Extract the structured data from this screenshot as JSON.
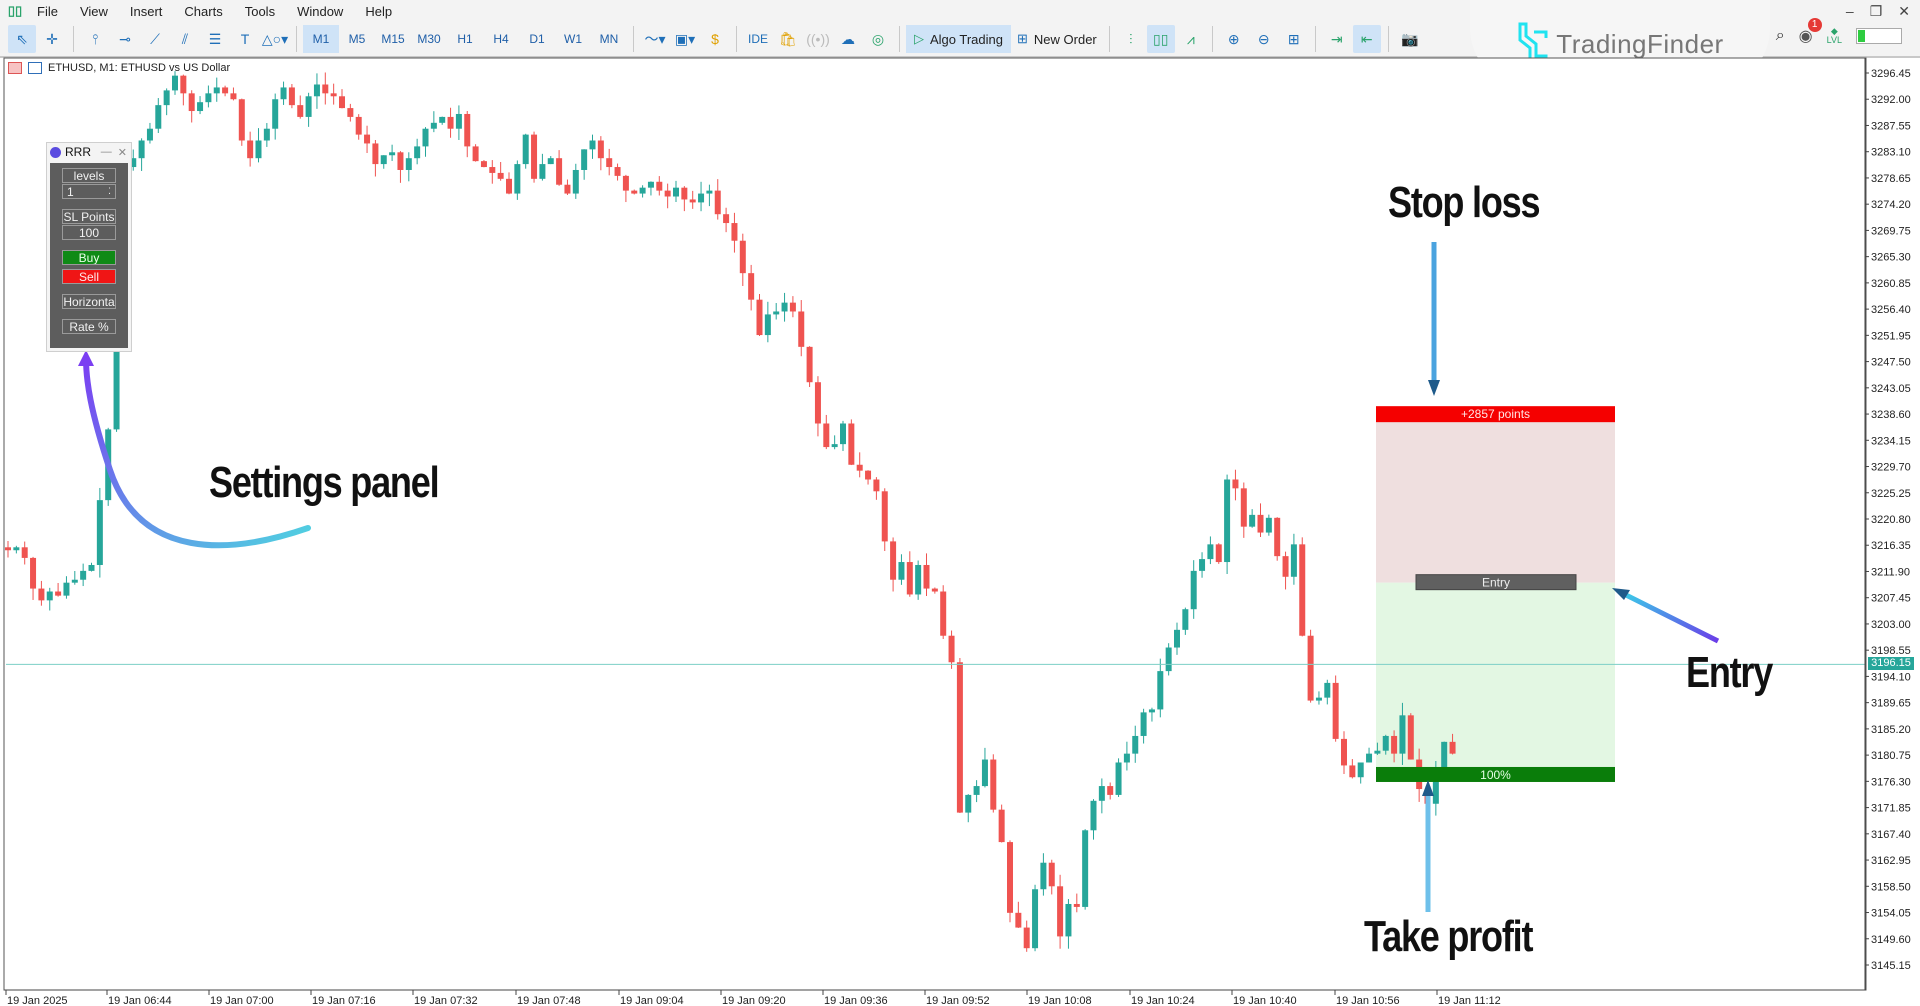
{
  "app": {
    "menu": [
      "File",
      "View",
      "Insert",
      "Charts",
      "Tools",
      "Window",
      "Help"
    ],
    "timeframes": [
      "M1",
      "M5",
      "M15",
      "M30",
      "H1",
      "H4",
      "D1",
      "W1",
      "MN"
    ],
    "active_timeframe": "M1",
    "toolbar": {
      "ide_label": "IDE",
      "algo_trading_label": "Algo Trading",
      "new_order_label": "New Order"
    },
    "notification_count": "1",
    "level_label": "LVL",
    "watermark": "TradingFinder"
  },
  "chart_header": {
    "title": "ETHUSD, M1:  ETHUSD vs US Dollar"
  },
  "settings_panel": {
    "title": "RRR",
    "levels_label": "levels",
    "levels_value": "1",
    "sl_points_label": "SL Points",
    "sl_points_value": "100",
    "buy_label": "Buy",
    "sell_label": "Sell",
    "horizontal_label": "Horizonta",
    "rate_label": "Rate %"
  },
  "annotations": {
    "settings_panel": "Settings panel",
    "stop_loss": "Stop loss",
    "entry": "Entry",
    "take_profit": "Take profit"
  },
  "rrr_box": {
    "sl_label": "+2857 points",
    "entry_label": "Entry",
    "tp_label": "100%",
    "sl_price": 3239.6,
    "entry_price": 3210.0,
    "tp_price": 3178.4,
    "colors": {
      "sl_bar": "#f50000",
      "sl_zone": "#efdfdf",
      "entry_bar": "#606060",
      "tp_zone": "#e3f7e3",
      "tp_bar": "#0a7d0a"
    }
  },
  "chart_data": {
    "type": "candlestick",
    "symbol": "ETHUSD",
    "timeframe": "M1",
    "current_price": 3196.15,
    "current_price_label": "3196.15",
    "ylim": [
      3142.0,
      3299.0
    ],
    "y_ticks": [
      "3296.45",
      "3292.00",
      "3287.55",
      "3283.10",
      "3278.65",
      "3274.20",
      "3269.75",
      "3265.30",
      "3260.85",
      "3256.40",
      "3251.95",
      "3247.50",
      "3243.05",
      "3238.60",
      "3234.15",
      "3229.70",
      "3225.25",
      "3220.80",
      "3216.35",
      "3211.90",
      "3207.45",
      "3203.00",
      "3198.55",
      "3194.10",
      "3189.65",
      "3185.20",
      "3180.75",
      "3176.30",
      "3171.85",
      "3167.40",
      "3162.95",
      "3158.50",
      "3154.05",
      "3149.60",
      "3145.15"
    ],
    "x_ticks": [
      "19 Jan 2025",
      "19 Jan 06:44",
      "19 Jan 07:00",
      "19 Jan 07:16",
      "19 Jan 07:32",
      "19 Jan 07:48",
      "19 Jan 09:04",
      "19 Jan 09:20",
      "19 Jan 09:36",
      "19 Jan 09:52",
      "19 Jan 10:08",
      "19 Jan 10:24",
      "19 Jan 10:40",
      "19 Jan 10:56",
      "19 Jan 11:12"
    ],
    "colors": {
      "up": "#26a69a",
      "down": "#ef5350",
      "price_line": "#7ccfc6"
    },
    "closes": [
      3215.5,
      3216.0,
      3214.2,
      3209.0,
      3207.0,
      3208.5,
      3207.8,
      3210.0,
      3210.5,
      3212.0,
      3213.0,
      3224.0,
      3236.0,
      3279.0,
      3280.5,
      3282.0,
      3285.0,
      3287.0,
      3291.0,
      3293.5,
      3296.0,
      3293.0,
      3290.0,
      3291.5,
      3293.0,
      3294.0,
      3293.0,
      3292.0,
      3285.0,
      3282.0,
      3285.0,
      3287.0,
      3292.0,
      3294.0,
      3291.0,
      3289.0,
      3292.5,
      3294.5,
      3293.0,
      3292.5,
      3290.5,
      3289.0,
      3286.0,
      3284.5,
      3281.0,
      3282.5,
      3283.0,
      3280.0,
      3282.0,
      3284.0,
      3287.0,
      3288.0,
      3289.0,
      3287.0,
      3289.5,
      3284.0,
      3281.5,
      3280.5,
      3279.5,
      3278.5,
      3276.0,
      3281.0,
      3286.0,
      3278.5,
      3281.0,
      3282.0,
      3277.5,
      3276.0,
      3280.0,
      3283.5,
      3285.0,
      3282.0,
      3280.5,
      3279.0,
      3276.5,
      3276.0,
      3277.0,
      3278.0,
      3276.5,
      3275.5,
      3277.0,
      3275.0,
      3274.5,
      3276.0,
      3276.5,
      3272.5,
      3271.0,
      3268.0,
      3262.5,
      3258.0,
      3252.0,
      3255.5,
      3256.0,
      3257.5,
      3256.0,
      3250.0,
      3244.0,
      3237.0,
      3233.0,
      3233.5,
      3237.0,
      3230.0,
      3229.0,
      3227.5,
      3225.5,
      3217.0,
      3210.5,
      3213.5,
      3208.0,
      3213.0,
      3209.0,
      3208.5,
      3201.0,
      3196.5,
      3171.0,
      3174.0,
      3175.5,
      3180.0,
      3171.5,
      3166.0,
      3154.0,
      3151.5,
      3148.0,
      3158.0,
      3162.5,
      3158.5,
      3150.0,
      3155.5,
      3155.0,
      3168.0,
      3173.0,
      3175.5,
      3174.0,
      3179.5,
      3181.0,
      3184.0,
      3188.0,
      3188.5,
      3195.0,
      3199.0,
      3202.0,
      3205.5,
      3212.0,
      3214.0,
      3216.5,
      3213.5,
      3227.5,
      3226.0,
      3219.5,
      3221.5,
      3218.5,
      3221.0,
      3214.5,
      3211.0,
      3216.5,
      3201.0,
      3190.0,
      3190.5,
      3193.0,
      3183.5,
      3179.0,
      3177.0,
      3179.5,
      3181.0,
      3181.5,
      3184.0,
      3181.0,
      3187.5,
      3180.0,
      3175.0,
      3172.5,
      3178.5,
      3183.0,
      3181.0
    ]
  }
}
